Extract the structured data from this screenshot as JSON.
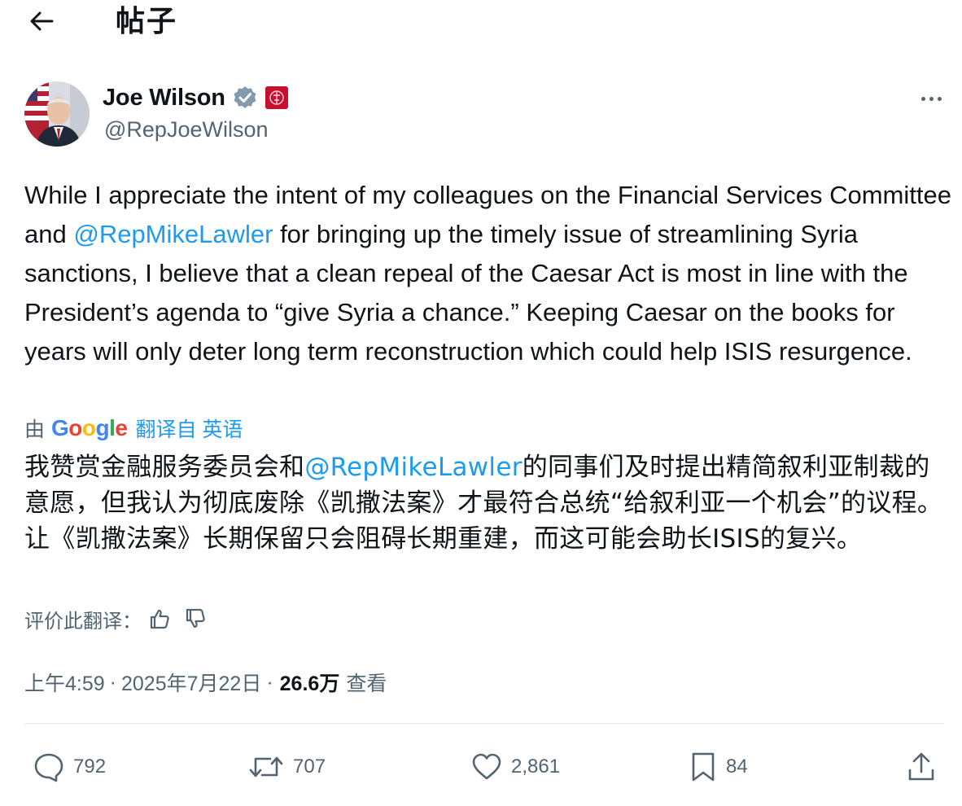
{
  "header": {
    "title": "帖子"
  },
  "author": {
    "display_name": "Joe Wilson",
    "handle": "@RepJoeWilson"
  },
  "tweet": {
    "text_before": "While I appreciate the intent of my colleagues on the Financial Services Committee and ",
    "mention": "@RepMikeLawler",
    "text_after": " for bringing up the timely issue of streamlining Syria sanctions, I believe that a clean repeal of the Caesar Act is most in line with the President’s agenda to “give Syria a chance.” Keeping Caesar on the books for years will only deter long term reconstruction which could help ISIS resurgence."
  },
  "translation": {
    "by_prefix": "由",
    "google_letters": [
      "G",
      "o",
      "o",
      "g",
      "l",
      "e"
    ],
    "from_label": "翻译自 英语",
    "text_before": "我赞赏金融服务委员会和",
    "mention": "@RepMikeLawler",
    "text_after": "的同事们及时提出精简叙利亚制裁的意愿，但我认为彻底废除《凯撒法案》才最符合总统“给叙利亚一个机会”的议程。让《凯撒法案》长期保留只会阻碍长期重建，而这可能会助长ISIS的复兴。",
    "rate_label": "评价此翻译："
  },
  "meta": {
    "time": "上午4:59",
    "separator": "·",
    "date": "2025年7月22日",
    "views_count": "26.6万",
    "views_label": "查看"
  },
  "actions": {
    "replies": "792",
    "reposts": "707",
    "likes": "2,861",
    "bookmarks": "84"
  },
  "colors": {
    "text": "#0f1419",
    "secondary": "#536471",
    "link": "#1d9bf0",
    "divider": "#e6ecf0"
  },
  "icons": {
    "back": "arrow-left-icon",
    "verified": "verified-badge-icon",
    "affiliation": "us-house-seal-icon",
    "more": "more-dots-icon",
    "thumbs_up": "thumbs-up-icon",
    "thumbs_down": "thumbs-down-icon",
    "reply": "reply-bubble-icon",
    "repost": "repost-icon",
    "like": "heart-icon",
    "bookmark": "bookmark-icon",
    "share": "share-upload-icon"
  }
}
